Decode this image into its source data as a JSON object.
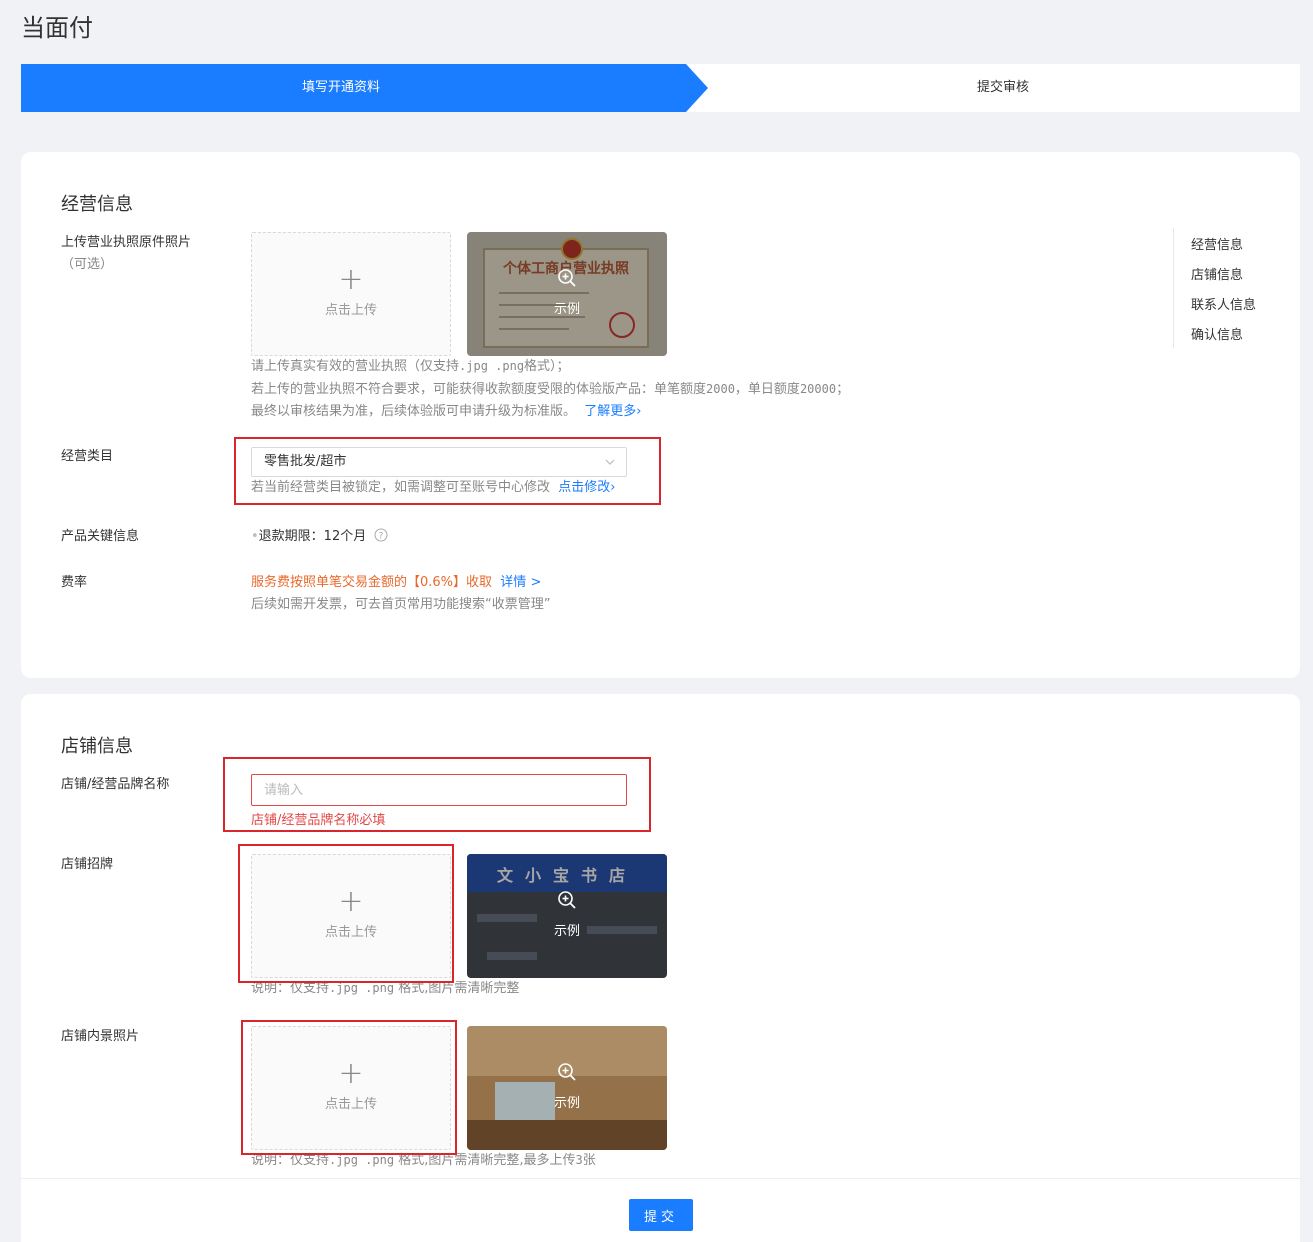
{
  "page": {
    "title": "当面付"
  },
  "steps": [
    {
      "label": "填写开通资料",
      "active": true
    },
    {
      "label": "提交审核",
      "active": false
    }
  ],
  "colors": {
    "primary": "#1a7cff",
    "error": "#e34848",
    "warning": "#e8692c",
    "frame": "#d9262c"
  },
  "anchor_nav": [
    "经营信息",
    "店铺信息",
    "联系人信息",
    "确认信息"
  ],
  "business": {
    "section_title": "经营信息",
    "license": {
      "label": "上传营业执照原件照片",
      "label_sub": "（可选）",
      "upload_text": "点击上传",
      "example_text": "示例",
      "example_image_title": "个体工商户营业执照",
      "help_line1_a": "请上传真实有效的营业执照（仅支持",
      "help_line1_b": ".jpg .png",
      "help_line1_c": "格式）；",
      "help_line2_a": "若上传的营业执照不符合要求，可能获得收款额度受限的体验版产品：单笔额度",
      "help_line2_b": "2000",
      "help_line2_c": "，单日额度",
      "help_line2_d": "20000",
      "help_line2_e": "；",
      "help_line3": "最终以审核结果为准，后续体验版可申请升级为标准版。",
      "learn_more": "了解更多"
    },
    "category": {
      "label": "经营类目",
      "value": "零售批发/超市",
      "help": "若当前经营类目被锁定，如需调整可至账号中心修改",
      "edit_link": "点击修改"
    },
    "product": {
      "label": "产品关键信息",
      "refund_period": "退款期限：12个月"
    },
    "rate": {
      "label": "费率",
      "text": "服务费按照单笔交易金额的【0.6%】收取",
      "detail_link": "详情",
      "note": "后续如需开发票，可去首页常用功能搜索“收票管理”"
    }
  },
  "store": {
    "section_title": "店铺信息",
    "brand": {
      "label": "店铺/经营品牌名称",
      "placeholder": "请输入",
      "error": "店铺/经营品牌名称必填"
    },
    "signboard": {
      "label": "店铺招牌",
      "upload_text": "点击上传",
      "example_text": "示例",
      "example_sign_text": "文小宝书店",
      "help_a": "说明：仅支持",
      "help_b": ".jpg .png",
      "help_c": "格式,图片需清晰完整"
    },
    "interior": {
      "label": "店铺内景照片",
      "upload_text": "点击上传",
      "example_text": "示例",
      "help_a": "说明：仅支持",
      "help_b": ".jpg .png",
      "help_c": "格式,图片需清晰完整,最多上传",
      "help_d": "3",
      "help_e": "张"
    }
  },
  "footer": {
    "submit_label": "提交"
  }
}
